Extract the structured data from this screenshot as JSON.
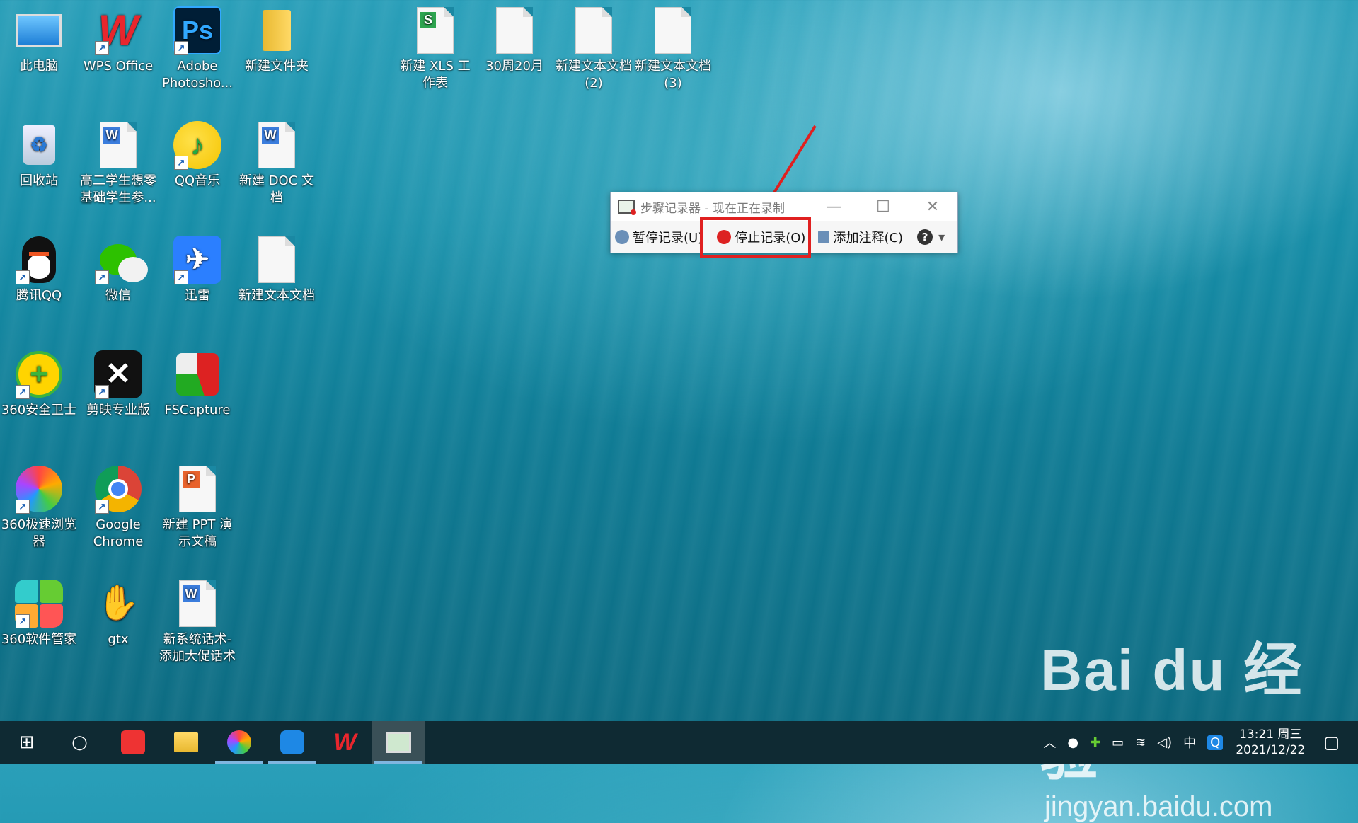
{
  "desktop_icons": [
    {
      "label": "此电脑"
    },
    {
      "label": "WPS Office"
    },
    {
      "label": "Adobe Photosho..."
    },
    {
      "label": "新建文件夹"
    },
    {
      "label": "新建 XLS 工作表"
    },
    {
      "label": "30周20月"
    },
    {
      "label": "新建文本文档 (2)"
    },
    {
      "label": "新建文本文档 (3)"
    },
    {
      "label": "回收站"
    },
    {
      "label": "高二学生想零基础学生参..."
    },
    {
      "label": "QQ音乐"
    },
    {
      "label": "新建 DOC 文档"
    },
    {
      "label": "腾讯QQ"
    },
    {
      "label": "微信"
    },
    {
      "label": "迅雷"
    },
    {
      "label": "新建文本文档"
    },
    {
      "label": "360安全卫士"
    },
    {
      "label": "剪映专业版"
    },
    {
      "label": "FSCapture"
    },
    {
      "label": "360极速浏览器"
    },
    {
      "label": "Google Chrome"
    },
    {
      "label": "新建 PPT 演示文稿"
    },
    {
      "label": "360软件管家"
    },
    {
      "label": "gtx"
    },
    {
      "label": "新系统话术-添加大促话术"
    }
  ],
  "step_recorder": {
    "title": "步骤记录器 - 现在正在录制",
    "pause_label": "暂停记录(U)",
    "stop_label": "停止记录(O)",
    "comment_label": "添加注释(C)",
    "minimize": "—",
    "maximize": "☐",
    "close": "✕",
    "help": "?",
    "menu": "▾"
  },
  "taskbar": {
    "start": "⊞",
    "search": "○",
    "ime": "中",
    "time": "13:21 周三",
    "date": "2021/12/22"
  },
  "watermark": {
    "brand": "Bai du 经验",
    "url": "jingyan.baidu.com"
  },
  "colors": {
    "highlight": "#e02020",
    "taskbar": "#0f2a33",
    "water": "#178ea8"
  }
}
